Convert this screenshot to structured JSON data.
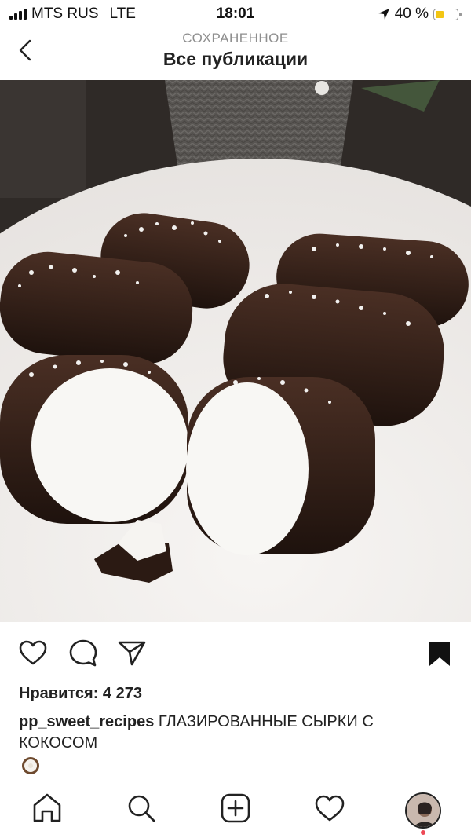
{
  "status_bar": {
    "carrier": "MTS RUS",
    "network": "LTE",
    "time": "18:01",
    "battery_percent": "40 %",
    "battery_level": 0.4
  },
  "header": {
    "subtitle": "СОХРАНЕННОЕ",
    "title": "Все публикации",
    "back_icon": "chevron-left-icon"
  },
  "post": {
    "photo_icon": "post-photo",
    "actions": [
      "heart-icon",
      "comment-icon",
      "share-icon",
      "bookmark-icon"
    ],
    "likes": "Нравится: 4 273",
    "username": "pp_sweet_recipes",
    "caption_text": " ГЛАЗИРОВАННЫЕ СЫРКИ С КОКОСОМ",
    "caption_emoji": "coconut-icon"
  },
  "tab_bar": {
    "items": [
      "home-icon",
      "search-icon",
      "new-post-icon",
      "activity-icon",
      "profile-avatar"
    ],
    "profile_notification_color": "#ed4956"
  },
  "colors": {
    "accent_battery": "#f3c613",
    "text_secondary": "#8e8e8e"
  }
}
